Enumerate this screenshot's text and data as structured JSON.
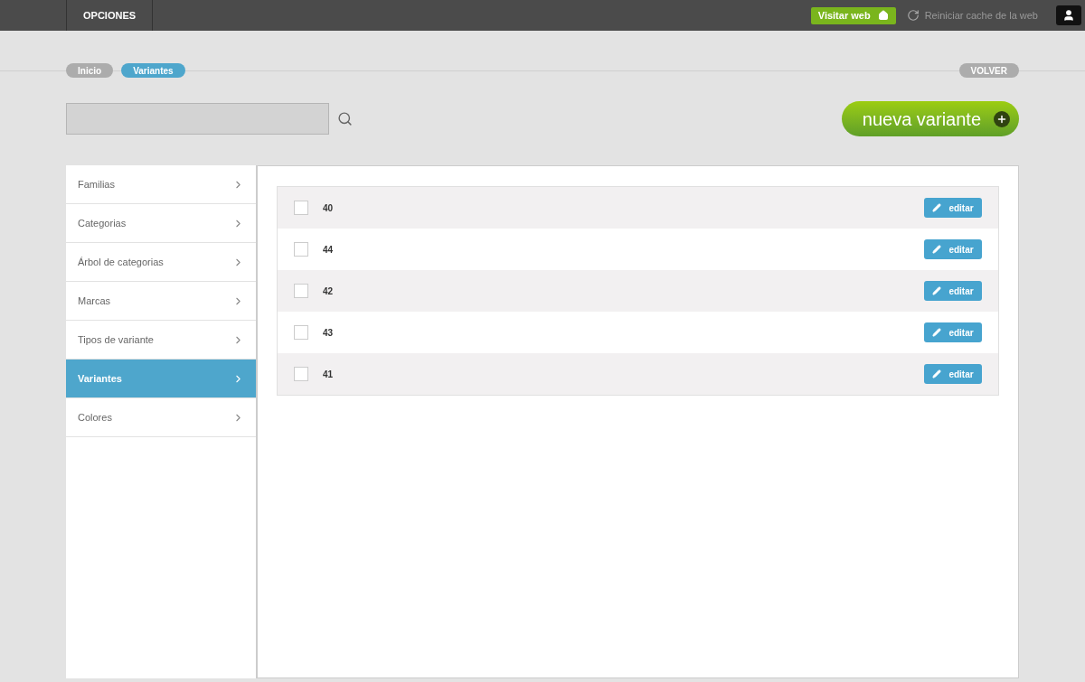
{
  "topbar": {
    "menu": "OPCIONES",
    "visit_button": "Visitar web",
    "cache_link": "Reiniciar cache de la web"
  },
  "breadcrumb": [
    {
      "label": "Inicio",
      "selected": false
    },
    {
      "label": "Variantes",
      "selected": true
    }
  ],
  "back_button": "VOLVER",
  "new_button": "nueva variante",
  "sidebar": {
    "items": [
      {
        "label": "Familias",
        "selected": false
      },
      {
        "label": "Categorias",
        "selected": false
      },
      {
        "label": "Árbol de categorias",
        "selected": false
      },
      {
        "label": "Marcas",
        "selected": false
      },
      {
        "label": "Tipos de variante",
        "selected": false
      },
      {
        "label": "Variantes",
        "selected": true
      },
      {
        "label": "Colores",
        "selected": false
      }
    ]
  },
  "rows": [
    {
      "name": "40",
      "checked": false,
      "action": "editar"
    },
    {
      "name": "44",
      "checked": false,
      "action": "editar"
    },
    {
      "name": "42",
      "checked": false,
      "action": "editar"
    },
    {
      "name": "43",
      "checked": false,
      "action": "editar"
    },
    {
      "name": "41",
      "checked": false,
      "action": "editar"
    }
  ]
}
